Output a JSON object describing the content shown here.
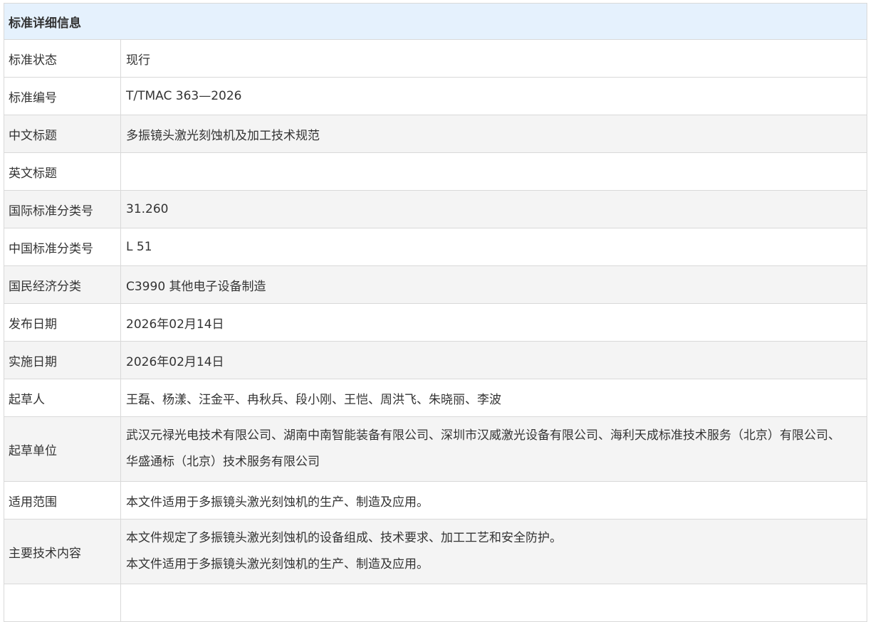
{
  "header": {
    "title": "标准详细信息"
  },
  "rows": [
    {
      "label": "标准状态",
      "value": "现行"
    },
    {
      "label": "标准编号",
      "value": "T/TMAC 363—2026"
    },
    {
      "label": "中文标题",
      "value": "多振镜头激光刻蚀机及加工技术规范"
    },
    {
      "label": "英文标题",
      "value": ""
    },
    {
      "label": "国际标准分类号",
      "value": "31.260"
    },
    {
      "label": "中国标准分类号",
      "value": "L 51"
    },
    {
      "label": "国民经济分类",
      "value": "C3990 其他电子设备制造"
    },
    {
      "label": "发布日期",
      "value": "2026年02月14日"
    },
    {
      "label": "实施日期",
      "value": "2026年02月14日"
    },
    {
      "label": "起草人",
      "value": "王磊、杨漾、汪金平、冉秋兵、段小刚、王恺、周洪飞、朱晓丽、李波"
    },
    {
      "label": "起草单位",
      "lines": [
        "武汉元禄光电技术有限公司、湖南中南智能装备有限公司、深圳市汉威激光设备有限公司、海利天成标准技术服务（北京）有限公司、",
        "华盛通标（北京）技术服务有限公司"
      ]
    },
    {
      "label": "适用范围",
      "value": "本文件适用于多振镜头激光刻蚀机的生产、制造及应用。"
    },
    {
      "label": "主要技术内容",
      "lines": [
        "本文件规定了多振镜头激光刻蚀机的设备组成、技术要求、加工工艺和安全防护。",
        "本文件适用于多振镜头激光刻蚀机的生产、制造及应用。"
      ]
    }
  ]
}
